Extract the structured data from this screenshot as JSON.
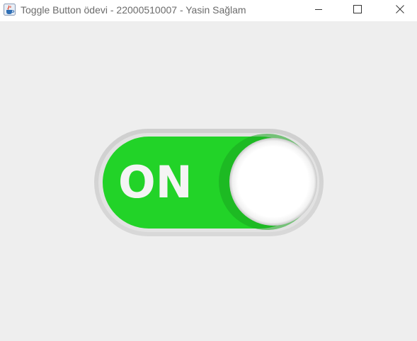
{
  "window": {
    "title": "Toggle Button ödevi - 22000510007 - Yasin Sağlam",
    "icon": "java-cup-icon",
    "controls": [
      "minimize-icon",
      "maximize-icon",
      "close-icon"
    ]
  },
  "toggle": {
    "label": "ON",
    "state": "on",
    "colors": {
      "on_track": "#22d328",
      "outline": "#d3d3d3",
      "knob": "#ffffff"
    }
  }
}
